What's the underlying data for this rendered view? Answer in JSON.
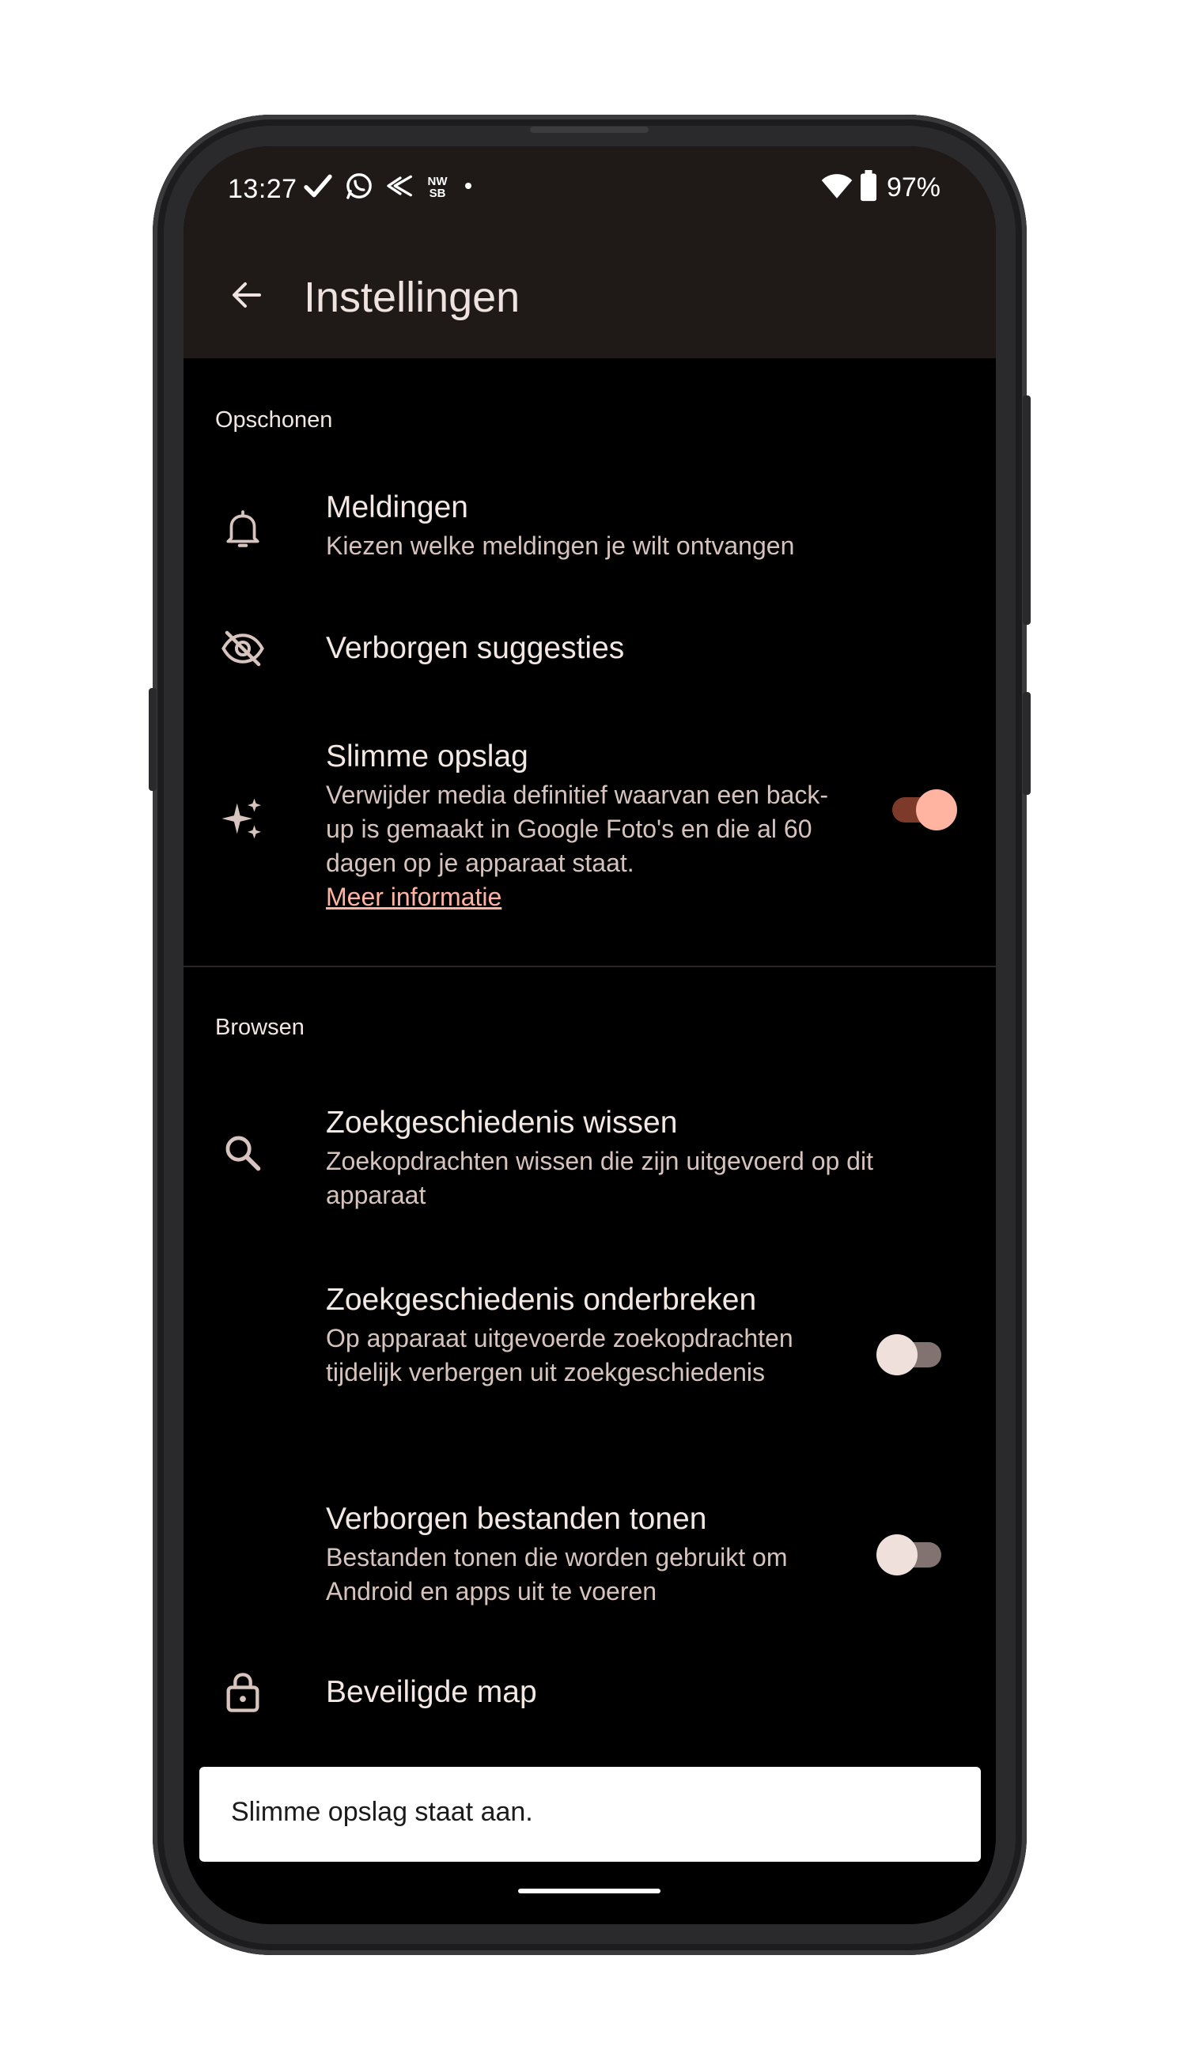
{
  "status_bar": {
    "time": "13:27",
    "left_icons": [
      "check-icon",
      "whatsapp-icon",
      "bird-app-icon",
      "nwsb-app-icon",
      "dot-icon"
    ],
    "nwsb_badge": "NW\nSB",
    "right_icons": [
      "wifi-icon",
      "battery-icon"
    ],
    "battery": "97%"
  },
  "app_bar": {
    "back_icon": "arrow-back-icon",
    "title": "Instellingen"
  },
  "sections": {
    "cleanup": {
      "header": "Opschonen",
      "items": [
        {
          "icon": "bell-icon",
          "title": "Meldingen",
          "subtitle": "Kiezen welke meldingen je wilt ontvangen"
        },
        {
          "icon": "eye-off-icon",
          "title": "Verborgen suggesties"
        },
        {
          "icon": "sparkle-icon",
          "title": "Slimme opslag",
          "subtitle": "Verwijder media definitief waarvan een back-up is gemaakt in Google Foto's en die al 60 dagen op je apparaat staat.",
          "link": "Meer informatie",
          "toggle_on": true
        }
      ]
    },
    "browse": {
      "header": "Browsen",
      "items": [
        {
          "icon": "search-icon",
          "title": "Zoekgeschiedenis wissen",
          "subtitle": "Zoekopdrachten wissen die zijn uitgevoerd op dit apparaat"
        },
        {
          "title": "Zoekgeschiedenis onderbreken",
          "subtitle": "Op apparaat uitgevoerde zoekopdrachten tijdelijk verbergen uit zoekgeschiedenis",
          "toggle_on": false
        },
        {
          "title": "Verborgen bestanden tonen",
          "subtitle": "Bestanden tonen die worden gebruikt om Android en apps uit te voeren",
          "toggle_on": false
        },
        {
          "icon": "lock-icon",
          "title": "Beveiligde map"
        }
      ]
    }
  },
  "snackbar": {
    "message": "Slimme opslag staat aan."
  },
  "colors": {
    "background": "#000000",
    "app_bar": "#1f1917",
    "text_primary": "#f3e8e4",
    "text_secondary": "#d6c3bd",
    "accent": "#ffb4a3",
    "toggle_on_track": "#7d3a2a",
    "toggle_on_thumb": "#ffb4a1",
    "toggle_off_track": "#837370",
    "toggle_off_thumb": "#efe0dc",
    "snackbar_bg": "#ffffff"
  }
}
